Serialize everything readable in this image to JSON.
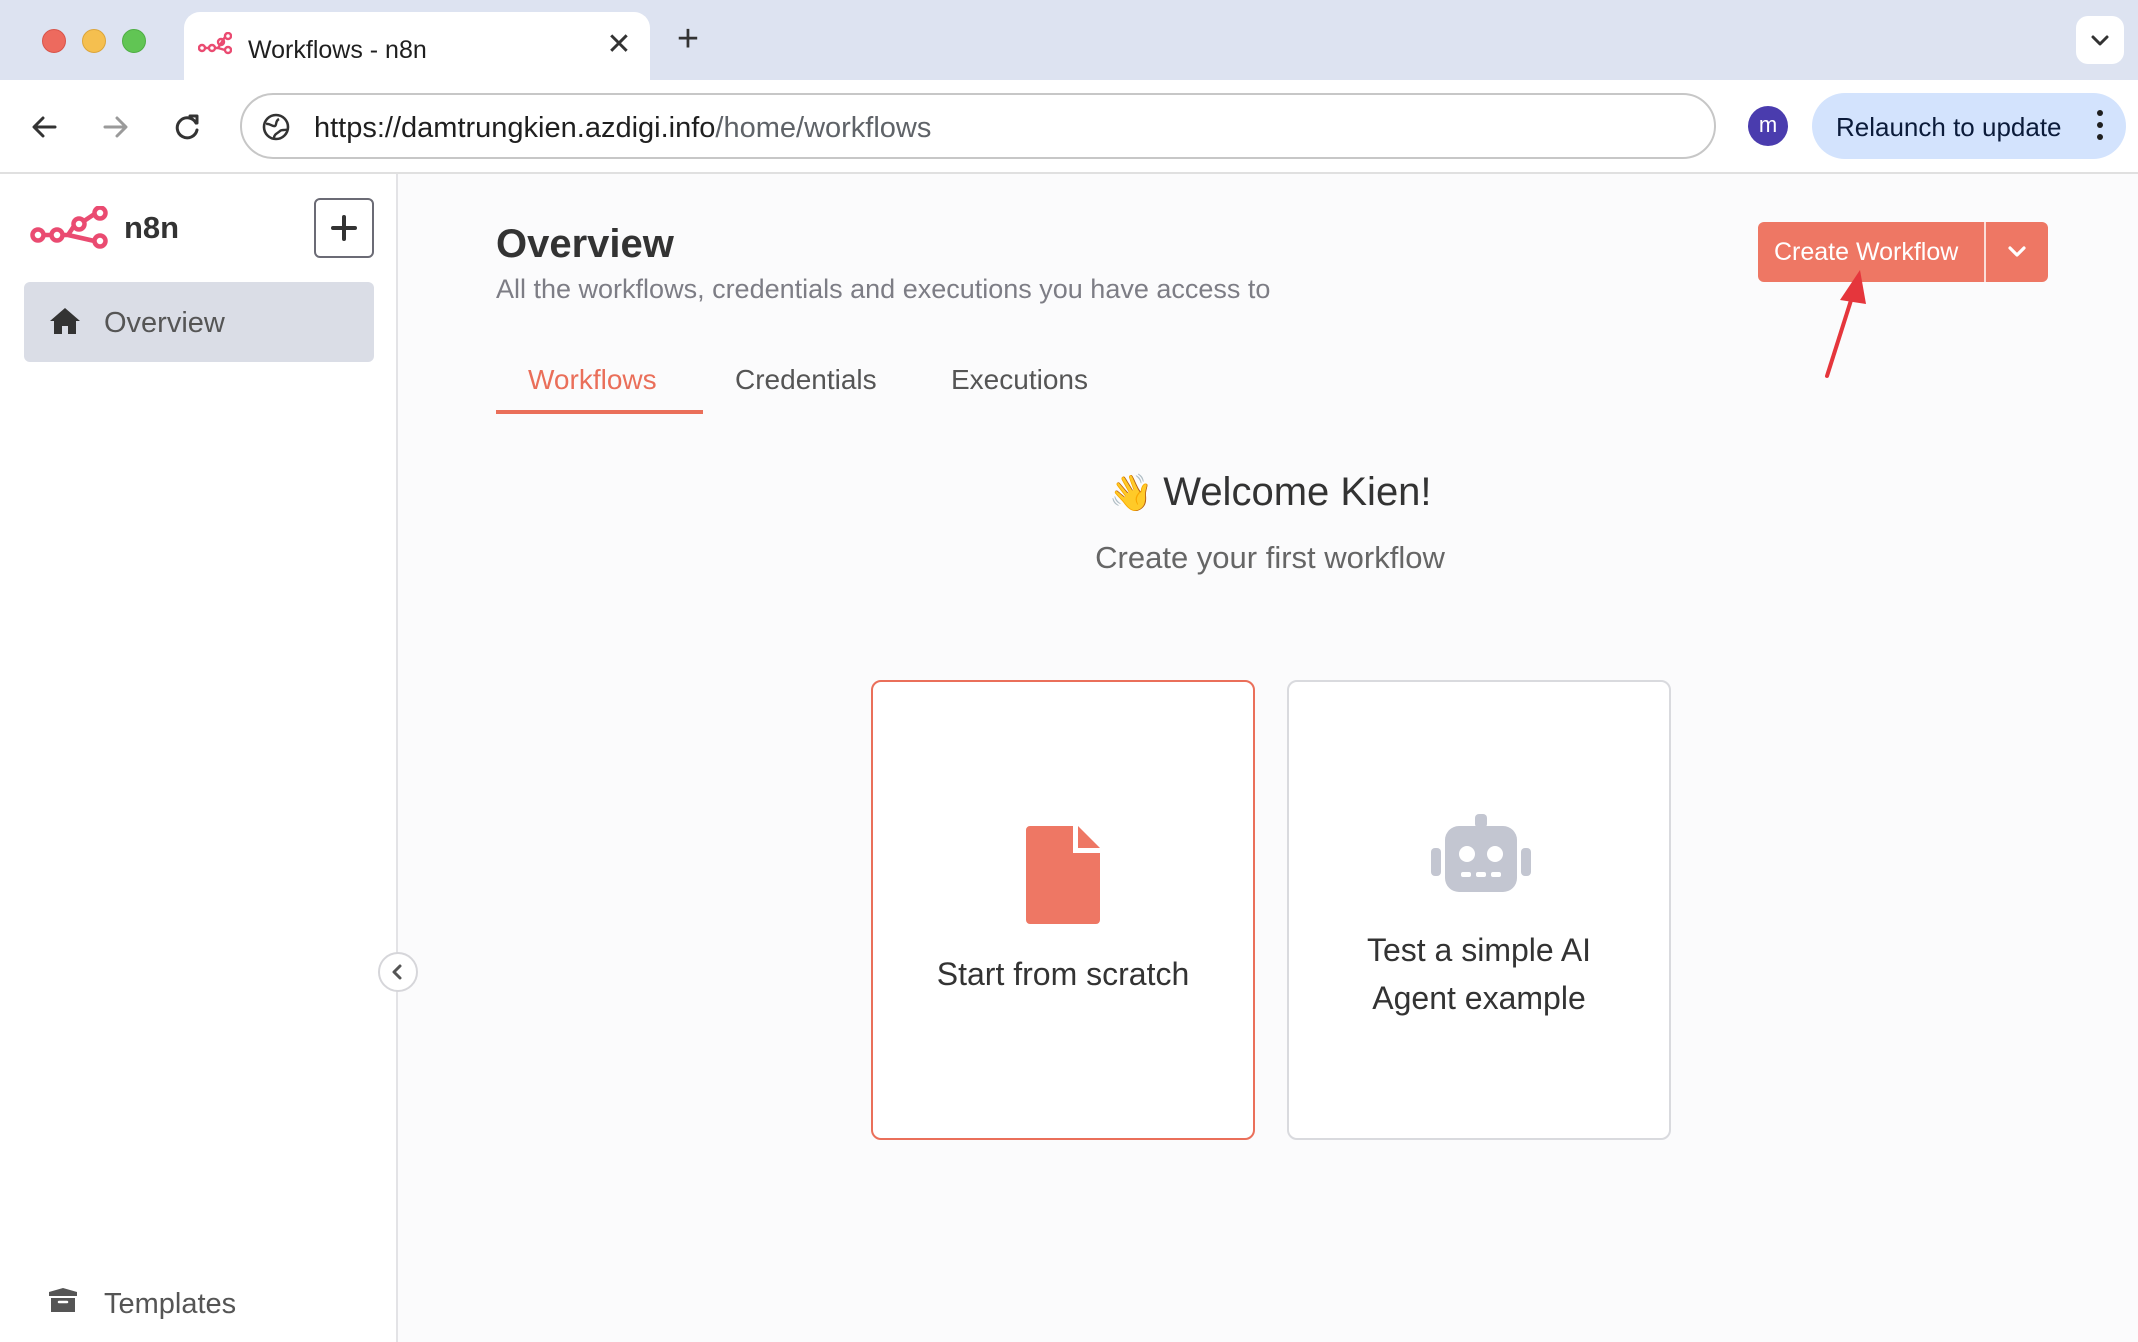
{
  "browser": {
    "tab_title": "Workflows - n8n",
    "url_host": "https://damtrungkien.azdigi.info",
    "url_path": "/home/workflows",
    "profile_initial": "m",
    "relaunch_label": "Relaunch to update",
    "new_tab_symbol": "+",
    "close_tab_symbol": "✕"
  },
  "sidebar": {
    "brand": "n8n",
    "items": [
      {
        "label": "Overview",
        "icon": "home-icon",
        "active": true
      },
      {
        "label": "Templates",
        "icon": "box-icon",
        "active": false
      }
    ]
  },
  "main": {
    "title": "Overview",
    "subtitle": "All the workflows, credentials and executions you have access to",
    "create_button_label": "Create Workflow",
    "tabs": [
      {
        "label": "Workflows",
        "active": true
      },
      {
        "label": "Credentials",
        "active": false
      },
      {
        "label": "Executions",
        "active": false
      }
    ],
    "welcome_emoji": "👋",
    "welcome": "Welcome Kien!",
    "welcome_sub": "Create your first workflow",
    "cards": [
      {
        "label": "Start from scratch",
        "icon": "file-icon",
        "selected": true
      },
      {
        "label": "Test a simple AI Agent example",
        "icon": "robot-icon",
        "selected": false
      }
    ]
  },
  "colors": {
    "accent": "#ee7764",
    "tabbar": "#dde3f1",
    "sidebar_active": "#dadde6",
    "robot_icon": "#c3c6d1",
    "annotation_arrow": "#e5363c"
  }
}
